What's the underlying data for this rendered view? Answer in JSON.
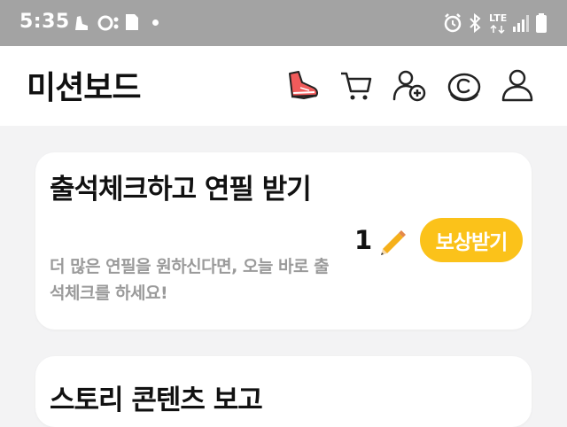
{
  "status_bar": {
    "time": "5:35",
    "network": "LTE"
  },
  "header": {
    "title": "미션보드",
    "icons": [
      "sneaker-icon",
      "cart-icon",
      "add-friend-icon",
      "coin-icon",
      "profile-icon"
    ]
  },
  "checkin_card": {
    "title": "출석체크하고 연필 받기",
    "description": "더 많은 연필을 원하신다면, 오늘 바로 출석체크를 하세요!",
    "reward_count": "1",
    "reward_button_label": "보상받기"
  },
  "next_card": {
    "title": "스토리 콘텐츠 보고"
  },
  "colors": {
    "accent": "#fbc21a",
    "status_bar": "#a3a3a3",
    "background": "#f3f3f4"
  }
}
